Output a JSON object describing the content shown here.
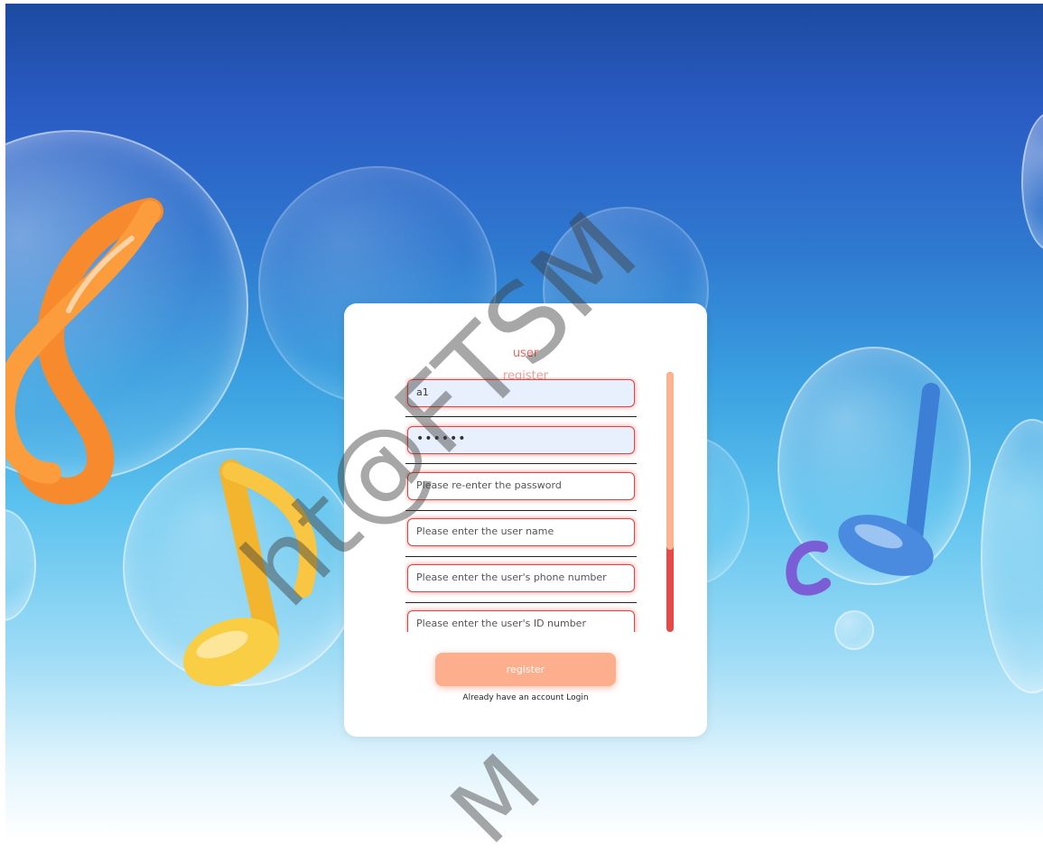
{
  "form": {
    "title_line1": "user",
    "title_line2": "register",
    "fields": {
      "account": {
        "value": "a1"
      },
      "password": {
        "value": "••••••"
      },
      "confirm_password": {
        "placeholder": "Please re-enter the password"
      },
      "user_name": {
        "placeholder": "Please enter the user name"
      },
      "phone": {
        "placeholder": "Please enter the user's phone number"
      },
      "id_number": {
        "placeholder": "Please enter the user's ID number"
      }
    },
    "register_label": "register",
    "login_prompt": "Already have an account Login"
  },
  "watermark": {
    "text_large": "ht@FTSM",
    "text_small": "M"
  },
  "colors": {
    "accent": "#f0635e",
    "button": "#fdae8d",
    "field_border": "#e3423f",
    "autofill_bg": "#e8f0fe"
  },
  "icons": [
    "treble-clef-icon",
    "eighth-note-icon",
    "quarter-note-icon",
    "bubble-icon"
  ]
}
